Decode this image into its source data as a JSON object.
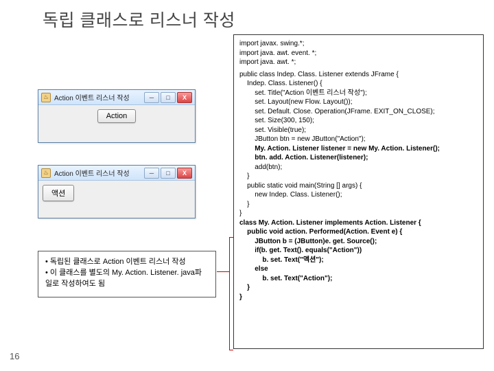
{
  "slide": {
    "title": "독립 클래스로 리스너 작성",
    "page_number": "16"
  },
  "windows": {
    "w1": {
      "title": "Action 이벤트 리스너 작성",
      "button_label": "Action",
      "min": "─",
      "max": "□",
      "close": "X"
    },
    "w2": {
      "title": "Action 이벤트 리스너 작성",
      "button_label": "액션",
      "min": "─",
      "max": "□",
      "close": "X"
    }
  },
  "desc": {
    "b1": "• 독립된 클래스로 Action 이벤트 리스너 작성",
    "b2": "• 이 클래스를 별도의 My. Action. Listener. java파",
    "b3": "일로 작성하여도 됨"
  },
  "code": {
    "l01": "import javax. swing.*;",
    "l02": "import java. awt. event. *;",
    "l03": "import java. awt. *;",
    "l04": "public class Indep. Class. Listener extends JFrame {",
    "l05": "    Indep. Class. Listener() {",
    "l06": "        set. Title(\"Action 이벤트 리스너 작성\");",
    "l07": "        set. Layout(new Flow. Layout());",
    "l08": "        set. Default. Close. Operation(JFrame. EXIT_ON_CLOSE);",
    "l09": "        set. Size(300, 150);",
    "l10": "        set. Visible(true);",
    "l11": "        JButton btn = new JButton(\"Action\");",
    "l12": "        My. Action. Listener listener = new My. Action. Listener();",
    "l13": "        btn. add. Action. Listener(listener);",
    "l14": "        add(btn);",
    "l15": "    }",
    "l16": "    public static void main(String [] args) {",
    "l17": "        new Indep. Class. Listener();",
    "l18": "    }",
    "l19": "}",
    "l20": "class My. Action. Listener implements Action. Listener {",
    "l21": "    public void action. Performed(Action. Event e) {",
    "l22": "        JButton b = (JButton)e. get. Source();",
    "l23": "        if(b. get. Text(). equals(\"Action\"))",
    "l24": "            b. set. Text(\"액션\");",
    "l25": "        else",
    "l26": "            b. set. Text(\"Action\");",
    "l27": "    }",
    "l28": "}"
  }
}
